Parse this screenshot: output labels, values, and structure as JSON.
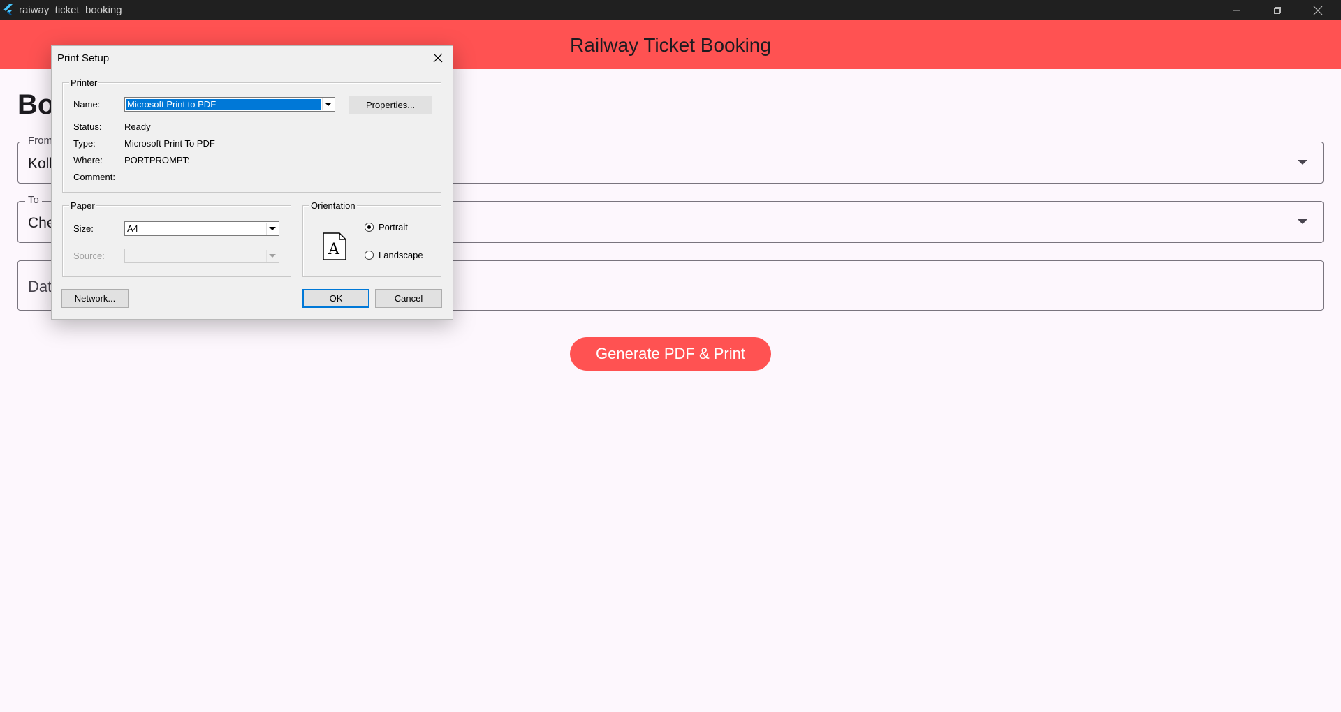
{
  "window": {
    "title": "raiway_ticket_booking"
  },
  "appbar": {
    "title": "Railway Ticket Booking"
  },
  "page": {
    "heading": "Bo",
    "from_label": "From",
    "from_value": "Koll",
    "to_label": "To",
    "to_value": "Che",
    "date_placeholder": "Dat",
    "generate_button": "Generate PDF & Print"
  },
  "dialog": {
    "title": "Print Setup",
    "printer": {
      "legend": "Printer",
      "name_label": "Name:",
      "name_value": "Microsoft Print to PDF",
      "properties_button": "Properties...",
      "status_label": "Status:",
      "status_value": "Ready",
      "type_label": "Type:",
      "type_value": "Microsoft Print To PDF",
      "where_label": "Where:",
      "where_value": "PORTPROMPT:",
      "comment_label": "Comment:",
      "comment_value": ""
    },
    "paper": {
      "legend": "Paper",
      "size_label": "Size:",
      "size_value": "A4",
      "source_label": "Source:",
      "source_value": ""
    },
    "orientation": {
      "legend": "Orientation",
      "portrait_label": "Portrait",
      "landscape_label": "Landscape",
      "selected": "Portrait",
      "icon_letter": "A"
    },
    "network_button": "Network...",
    "ok_button": "OK",
    "cancel_button": "Cancel"
  },
  "colors": {
    "accent": "#ff5252",
    "selection": "#0078d7",
    "background": "#fdf7fd"
  },
  "icons": {
    "app_logo": "flutter-logo-icon",
    "close": "close-icon",
    "minimize": "minimize-icon",
    "restore": "restore-icon",
    "dropdown": "dropdown-arrow-icon",
    "orientation": "portrait-page-icon"
  }
}
